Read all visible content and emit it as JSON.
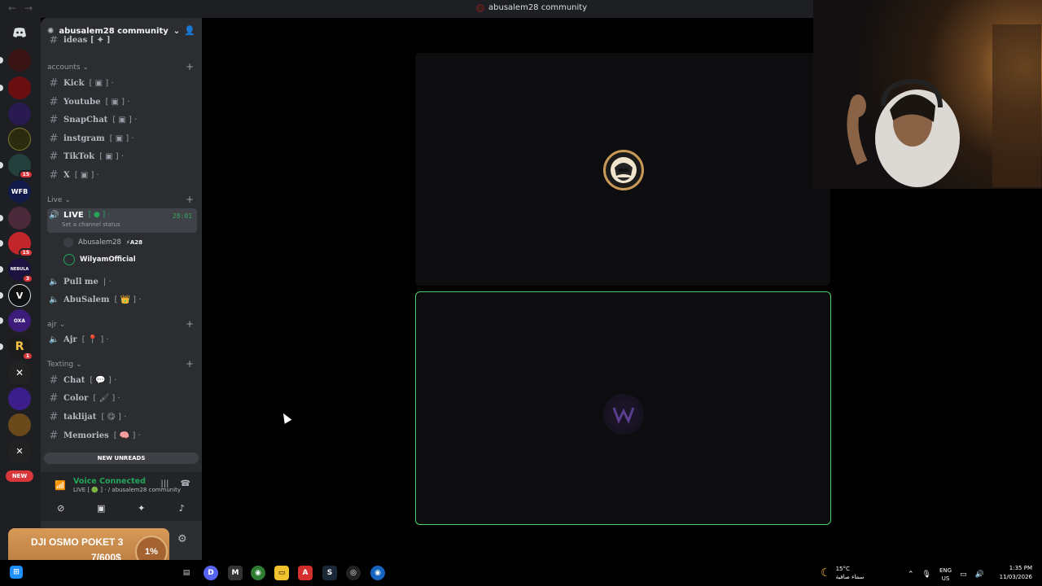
{
  "window": {
    "title": "abusalem28 community"
  },
  "server_rail": {
    "items": [
      {
        "name": "discord-home",
        "color": "#5865f2",
        "badge": ""
      },
      {
        "name": "server-1",
        "color": "#3a1414",
        "badge": ""
      },
      {
        "name": "server-2",
        "color": "#6b0e12",
        "badge": ""
      },
      {
        "name": "server-3",
        "color": "#2a1a52",
        "badge": ""
      },
      {
        "name": "server-4",
        "color": "#2b2b0f",
        "badge": ""
      },
      {
        "name": "server-5",
        "color": "#23403d",
        "badge": "15"
      },
      {
        "name": "server-wfb",
        "color": "#121a4a",
        "badge": ""
      },
      {
        "name": "server-7",
        "color": "#4a2a3a",
        "badge": ""
      },
      {
        "name": "server-8",
        "color": "#c2262b",
        "badge": "15"
      },
      {
        "name": "server-nebula",
        "color": "#1d1140",
        "badge": "3"
      },
      {
        "name": "server-v",
        "color": "#111214",
        "badge": ""
      },
      {
        "name": "server-oxa",
        "color": "#3d1c7a",
        "badge": ""
      },
      {
        "name": "server-13",
        "color": "#1c1c1c",
        "badge": "1"
      },
      {
        "name": "server-14",
        "color": "#222",
        "badge": ""
      },
      {
        "name": "server-15",
        "color": "#3b1e8a",
        "badge": ""
      },
      {
        "name": "server-16",
        "color": "#6a4a1a",
        "badge": ""
      }
    ],
    "wfb_label": "WFB",
    "nebula_label": "NEBULA",
    "v_label": "V",
    "oxa_label": "OXA",
    "new_label": "NEW"
  },
  "guild": {
    "name": "abusalem28 community"
  },
  "categories": {
    "accounts": "accounts",
    "live": "Live",
    "ajr": "ajr",
    "texting": "Texting"
  },
  "channels": {
    "clipped_top": "ideas [ ✦ ]",
    "kick": "Kick",
    "youtube": "Youtube",
    "snapchat": "SnapChat",
    "instgram": "instgram",
    "tiktok": "TikTok",
    "x": "X",
    "live": "LIVE",
    "live_timer": "28:01",
    "live_status": "Set a channel status",
    "pull_me": "Pull me",
    "abusalem": "AbuSalem",
    "ajr": "Ajr",
    "chat": "Chat",
    "color": "Color",
    "taklijat": "taklijat",
    "memories": "Memories"
  },
  "channel_suffix": "[ ▣ ] ·",
  "voice_members": [
    {
      "name": "Abusalem28",
      "tag": "⚡A28"
    },
    {
      "name": "WilyamOfficial",
      "tag": ""
    }
  ],
  "new_unreads": "NEW UNREADS",
  "voice": {
    "status": "Voice Connected",
    "channel": "LIVE [ 🟢 ] · / abusalem28 community"
  },
  "goal": {
    "title": "DJI OSMO POKET 3",
    "amount": "7/600$",
    "percent": "1%"
  },
  "taskbar": {
    "weather_temp": "15°C",
    "weather_desc": "سماء صافية",
    "lang_top": "ENG",
    "lang_bottom": "US",
    "time": "1:35 PM",
    "date": "11/03/2026"
  },
  "colors": {
    "accent_green": "#23a55a",
    "speaking_border": "#4fcf6c",
    "goal_orange": "#d79a58",
    "badge_red": "#da373c"
  }
}
